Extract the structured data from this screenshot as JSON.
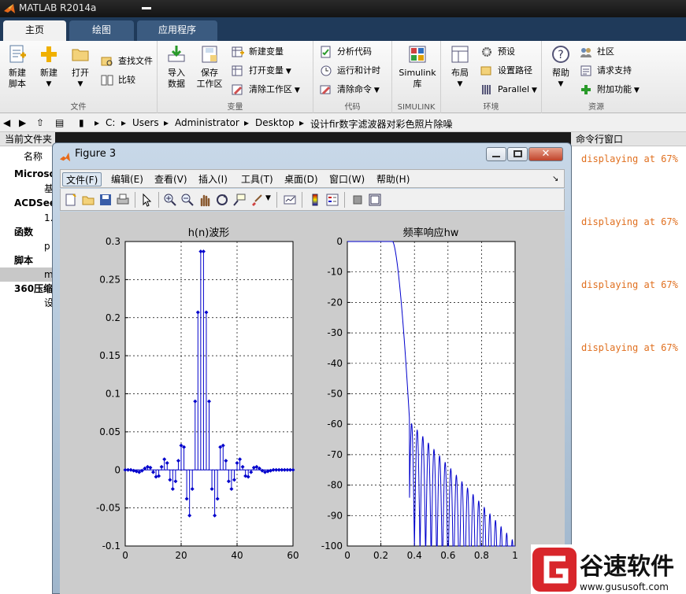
{
  "app": {
    "title": "MATLAB R2014a"
  },
  "tabs": [
    {
      "label": "主页",
      "active": true
    },
    {
      "label": "绘图",
      "active": false
    },
    {
      "label": "应用程序",
      "active": false
    }
  ],
  "ribbon": {
    "file": {
      "label": "文件",
      "new_script": "新建\n脚本",
      "new": "新建",
      "open": "打开",
      "find_files": "查找文件",
      "compare": "比较"
    },
    "variable": {
      "label": "变量",
      "import": "导入\n数据",
      "save_ws": "保存\n工作区",
      "new_var": "新建变量",
      "open_var": "打开变量",
      "clear_ws": "清除工作区"
    },
    "code": {
      "label": "代码",
      "analyze": "分析代码",
      "run_time": "运行和计时",
      "clear_cmd": "清除命令"
    },
    "simulink": {
      "label": "SIMULINK",
      "btn": "Simulink\n库"
    },
    "env": {
      "label": "环境",
      "layout": "布局",
      "prefs": "预设",
      "set_path": "设置路径",
      "parallel": "Parallel"
    },
    "resources": {
      "label": "资源",
      "help": "帮助",
      "community": "社区",
      "support": "请求支持",
      "addons": "附加功能"
    }
  },
  "address": {
    "parts": [
      "C:",
      "Users",
      "Administrator",
      "Desktop",
      "设计fir数字滤波器对彩色照片除噪"
    ]
  },
  "left_panel": {
    "title": "当前文件夹",
    "col_name": "名称",
    "rows": [
      {
        "text": "Microso",
        "bold": true
      },
      {
        "text": "基",
        "bold": false
      },
      {
        "text": "ACDSee",
        "bold": true
      },
      {
        "text": "1.",
        "bold": false
      },
      {
        "text": "函数",
        "bold": true
      },
      {
        "text": "p",
        "bold": false
      },
      {
        "text": "脚本",
        "bold": true
      },
      {
        "text": "m",
        "bold": false
      },
      {
        "text": "360压缩",
        "bold": true
      },
      {
        "text": "设",
        "bold": false
      }
    ]
  },
  "command": {
    "title": "命令行窗口",
    "lines": [
      "displaying at 67%",
      "displaying at 67%",
      "displaying at 67%",
      "displaying at 67%"
    ]
  },
  "figure": {
    "title": "Figure 3",
    "menu": [
      "文件(F)",
      "编辑(E)",
      "查看(V)",
      "插入(I)",
      "工具(T)",
      "桌面(D)",
      "窗口(W)",
      "帮助(H)"
    ],
    "toolbar_icons": [
      "new-figure-icon",
      "open-file-icon",
      "save-icon",
      "print-icon",
      "pointer-icon",
      "zoom-in-icon",
      "zoom-out-icon",
      "pan-icon",
      "rotate-icon",
      "data-cursor-icon",
      "brush-icon",
      "link-plot-icon",
      "colorbar-icon",
      "legend-icon",
      "hide-tools-icon",
      "show-tools-icon"
    ]
  },
  "chart_data": [
    {
      "type": "stem",
      "title": "h(n)波形",
      "xlim": [
        0,
        60
      ],
      "ylim": [
        -0.1,
        0.3
      ],
      "xticks": [
        "0",
        "20",
        "40",
        "60"
      ],
      "yticks": [
        "-0.1",
        "-0.05",
        "0",
        "0.05",
        "0.1",
        "0.15",
        "0.2",
        "0.25",
        "0.3"
      ],
      "grid": true,
      "color": "#0000cc",
      "n": [
        0,
        1,
        2,
        3,
        4,
        5,
        6,
        7,
        8,
        9,
        10,
        11,
        12,
        13,
        14,
        15,
        16,
        17,
        18,
        19,
        20,
        21,
        22,
        23,
        24,
        25,
        26,
        27,
        28,
        29,
        30,
        31,
        32,
        33,
        34,
        35,
        36,
        37,
        38,
        39,
        40,
        41,
        42,
        43,
        44,
        45,
        46,
        47,
        48,
        49,
        50,
        51,
        52,
        53,
        54,
        55,
        56,
        57,
        58,
        59,
        60
      ],
      "values": [
        0,
        0,
        0,
        -0.001,
        -0.002,
        -0.003,
        -0.001,
        0.002,
        0.004,
        0.003,
        -0.003,
        -0.009,
        -0.008,
        0.004,
        0.014,
        0.009,
        -0.013,
        -0.025,
        -0.015,
        0.012,
        0.032,
        0.03,
        -0.038,
        -0.06,
        -0.025,
        0.09,
        0.207,
        0.287,
        0.287,
        0.207,
        0.09,
        -0.025,
        -0.06,
        -0.038,
        0.03,
        0.032,
        0.012,
        -0.015,
        -0.025,
        -0.013,
        0.009,
        0.014,
        0.004,
        -0.008,
        -0.009,
        -0.003,
        0.003,
        0.004,
        0.002,
        -0.001,
        -0.003,
        -0.002,
        -0.001,
        0,
        0,
        0,
        0,
        0,
        0,
        0,
        0
      ]
    },
    {
      "type": "line",
      "title": "频率响应hw",
      "xlim": [
        0,
        1
      ],
      "ylim": [
        -100,
        0
      ],
      "xticks": [
        "0",
        "0.2",
        "0.4",
        "0.6",
        "0.8",
        "1"
      ],
      "yticks": [
        "0",
        "-10",
        "-20",
        "-30",
        "-40",
        "-50",
        "-60",
        "-70",
        "-80",
        "-90",
        "-100"
      ],
      "grid": true,
      "color": "#0000cc",
      "passband_edge": 0.27,
      "transition_end": 0.37,
      "sidelobe_start": -55,
      "sidelobe_end": -95
    }
  ]
}
